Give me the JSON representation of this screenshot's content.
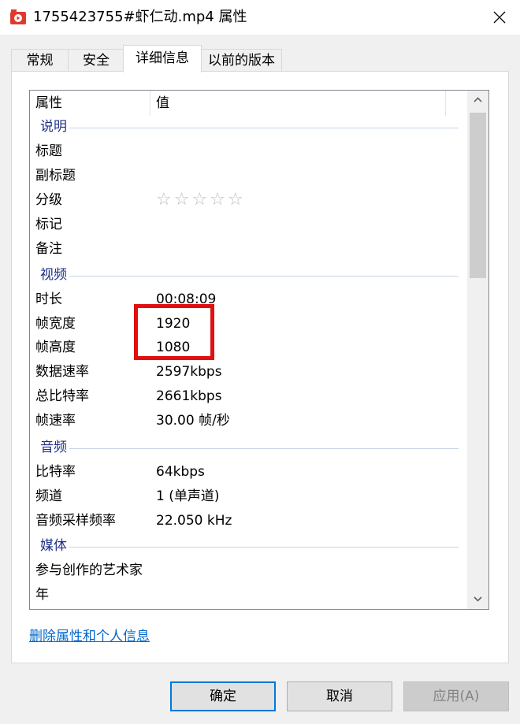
{
  "window": {
    "title": "1755423755#虾仁动.mp4 属性",
    "icon": "video-file-icon",
    "close_icon": "close-icon"
  },
  "tabs": [
    {
      "label": "常规",
      "active": false
    },
    {
      "label": "安全",
      "active": false
    },
    {
      "label": "详细信息",
      "active": true
    },
    {
      "label": "以前的版本",
      "active": false
    }
  ],
  "details": {
    "columns": {
      "property": "属性",
      "value": "值"
    },
    "groups": {
      "description": {
        "label": "说明",
        "rows": [
          {
            "key": "标题",
            "value": ""
          },
          {
            "key": "副标题",
            "value": ""
          },
          {
            "key": "分级",
            "value": "",
            "rating_stars": 0,
            "rating_max": 5
          },
          {
            "key": "标记",
            "value": ""
          },
          {
            "key": "备注",
            "value": ""
          }
        ]
      },
      "video": {
        "label": "视频",
        "rows": [
          {
            "key": "时长",
            "value": "00:08:09"
          },
          {
            "key": "帧宽度",
            "value": "1920"
          },
          {
            "key": "帧高度",
            "value": "1080"
          },
          {
            "key": "数据速率",
            "value": "2597kbps"
          },
          {
            "key": "总比特率",
            "value": "2661kbps"
          },
          {
            "key": "帧速率",
            "value": "30.00 帧/秒"
          }
        ]
      },
      "audio": {
        "label": "音频",
        "rows": [
          {
            "key": "比特率",
            "value": "64kbps"
          },
          {
            "key": "频道",
            "value": "1 (单声道)"
          },
          {
            "key": "音频采样频率",
            "value": "22.050 kHz"
          }
        ]
      },
      "media": {
        "label": "媒体",
        "rows": [
          {
            "key": "参与创作的艺术家",
            "value": ""
          },
          {
            "key": "年",
            "value": ""
          }
        ]
      }
    },
    "rating_glyphs": "☆☆☆☆☆"
  },
  "remove_link": "删除属性和个人信息",
  "buttons": {
    "ok": "确定",
    "cancel": "取消",
    "apply": "应用(A)"
  },
  "colors": {
    "group_label": "#1e3287",
    "link": "#0066cc",
    "highlight_box": "#e01010",
    "default_button_border": "#0078d7"
  }
}
